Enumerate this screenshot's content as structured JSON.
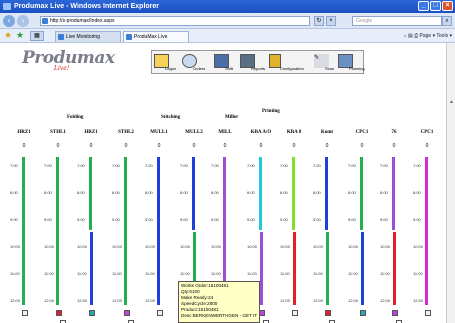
{
  "window": {
    "title": "Produmax Live - Windows Internet Explorer"
  },
  "address": {
    "url": "http://s-produmax/Index.aspx",
    "search_placeholder": "Google"
  },
  "tabs": [
    {
      "label": "Live Monitoring"
    },
    {
      "label": "ProduMax Live"
    }
  ],
  "browser_tools": {
    "page_label": "Page",
    "tools_label": "Tools"
  },
  "app": {
    "logo": "Produmax",
    "logo_sub": "Live!"
  },
  "toolbar": {
    "items": [
      {
        "label": "Logon"
      },
      {
        "label": "Orders"
      },
      {
        "label": "Shift"
      },
      {
        "label": "Reports"
      },
      {
        "label": "Configuration"
      },
      {
        "label": "Scan"
      },
      {
        "label": "Planning"
      }
    ]
  },
  "sections": [
    "Folding",
    "Stitching",
    "Miller",
    "Printing"
  ],
  "machines": [
    {
      "name": "HRZ1",
      "count": "0"
    },
    {
      "name": "STHL1",
      "count": "0"
    },
    {
      "name": "HRZ1",
      "count": "0"
    },
    {
      "name": "STHL2",
      "count": "0"
    },
    {
      "name": "MULL1",
      "count": "0"
    },
    {
      "name": "MULL2",
      "count": "0"
    },
    {
      "name": "MILL",
      "count": "0"
    },
    {
      "name": "KBA A/O",
      "count": "0"
    },
    {
      "name": "KBA 8",
      "count": "0"
    },
    {
      "name": "Komt",
      "count": "0"
    },
    {
      "name": "CPC1",
      "count": "0"
    },
    {
      "name": "76",
      "count": "0"
    },
    {
      "name": "CPC1",
      "count": "0"
    }
  ],
  "time_ticks": [
    "7:00",
    "8:00",
    "9:00",
    "10:00",
    "11:00",
    "12:00"
  ],
  "tooltip": {
    "lines": [
      "Works Order:16100481",
      "Qty:5100",
      "Make Ready:24",
      "SpeedCycle:2800",
      "Product:16100481",
      "Desc:BERKENWERTHGEN - GET IT MAGAZINE"
    ]
  },
  "colors": {
    "green": "#22b14c",
    "blue": "#1e3fd8",
    "purple": "#9b4fd6",
    "red": "#e0202a",
    "cyan": "#22c8e0",
    "lime": "#7ee02a",
    "magenta": "#d22ec8"
  }
}
